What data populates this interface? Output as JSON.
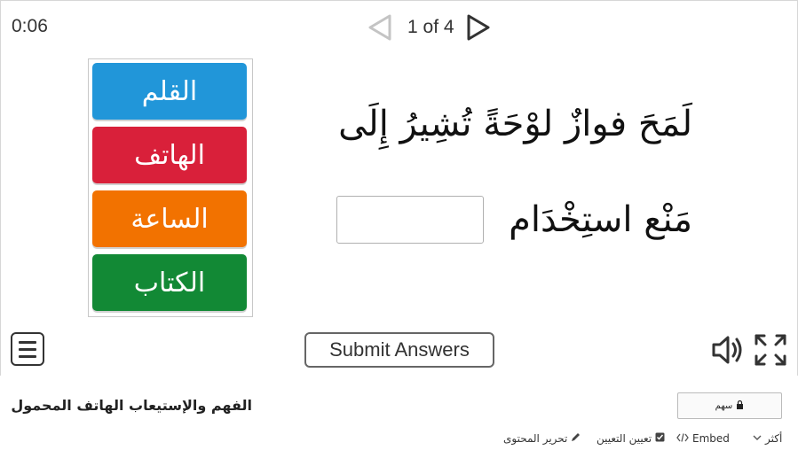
{
  "timer": "0:06",
  "navigation": {
    "counter": "1 of 4",
    "prev_icon": "triangle-left-outline-icon",
    "next_icon": "triangle-right-outline-icon"
  },
  "tiles": [
    {
      "label": "القلم",
      "color": "#2196d9"
    },
    {
      "label": "الهاتف",
      "color": "#d9203a"
    },
    {
      "label": "الساعة",
      "color": "#f27200"
    },
    {
      "label": "الكتاب",
      "color": "#128935"
    }
  ],
  "sentence": {
    "line1": "لَمَحَ فوازٌ لوْحَةً تُشِيرُ إِلَى",
    "line2": "مَنْع استِخْدَام"
  },
  "controls": {
    "submit_label": "Submit Answers",
    "menu_icon": "hamburger-menu-icon",
    "sound_icon": "speaker-icon",
    "fullscreen_icon": "fullscreen-icon"
  },
  "footer": {
    "activity_title": "الفهم والإستيعاب الهاتف المحمول",
    "share_label": "سهم",
    "more_label": "أكثر",
    "embed_label": "Embed",
    "assign_label": "تعيين التعيين",
    "edit_label": "تحرير المحتوى"
  }
}
